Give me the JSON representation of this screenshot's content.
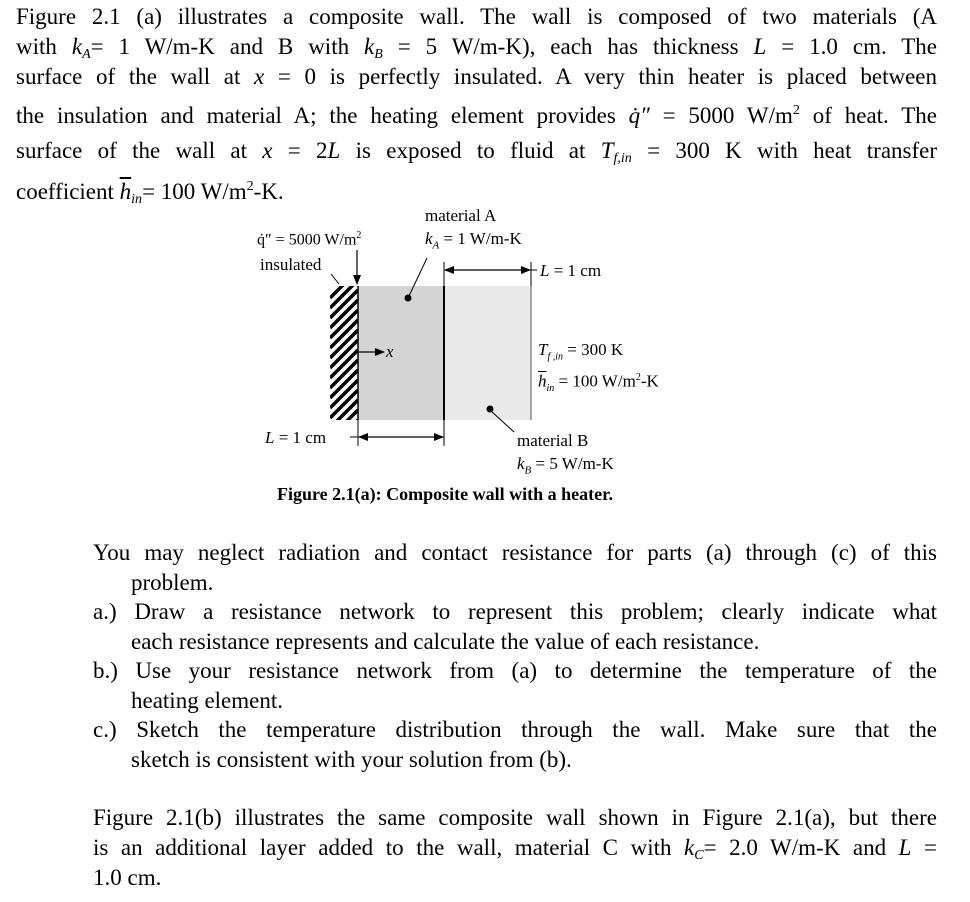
{
  "intro": {
    "lines": [
      [
        "Figure 2.1 (a) illustrates a composite wall.  The wall is composed of two materials (A"
      ],
      [
        "with ",
        "k_A",
        "= 1 W/m-K and B with ",
        "k_B",
        " = 5 W/m-K), each has thickness ",
        "L",
        " = 1.0 cm.  The"
      ],
      [
        "surface of the wall at ",
        "x",
        " = 0 is perfectly insulated.  A very thin heater is placed between"
      ],
      [
        "the insulation and material A; the heating element provides ",
        "q_dot",
        " = 5000 W/m",
        "2",
        " of heat.  The"
      ],
      [
        "surface of the wall at ",
        "x",
        " = 2",
        "L",
        " is exposed to fluid at ",
        "T_f,in",
        " = 300 K with heat transfer"
      ],
      [
        "coefficient ",
        "h_in",
        "= 100 W/m",
        "2",
        "-K."
      ]
    ],
    "text": {
      "l1": "Figure 2.1 (a) illustrates a composite wall.  The wall is composed of two materials (A",
      "l2a": "with ",
      "l2_kA": "k",
      "l2_kA_sub": "A",
      "l2b": "= 1 W/m-K and B with ",
      "l2_kB": "k",
      "l2_kB_sub": "B",
      "l2c": " = 5 W/m-K), each has thickness ",
      "l2_L": "L",
      "l2d": " = 1.0 cm.  The",
      "l3a": "surface of the wall at ",
      "l3_x": "x",
      "l3b": " = 0 is perfectly insulated.  A very thin heater is placed between",
      "l4a": "the insulation and material A; the heating element provides ",
      "l4_q": "q̇″",
      "l4b": " = 5000 W/m",
      "l4_sup": "2",
      "l4c": " of heat.  The",
      "l5a": "surface of the wall at ",
      "l5_x": "x",
      "l5b": " = 2",
      "l5_L": "L",
      "l5c": " is exposed to fluid at ",
      "l5_T": "T",
      "l5_T_sub": "f,in",
      "l5d": " = 300 K with heat transfer",
      "l6a": "coefficient ",
      "l6_h": "h",
      "l6_h_sub": "in",
      "l6b": "= 100 W/m",
      "l6_sup": "2",
      "l6c": "-K."
    }
  },
  "figure": {
    "heat_flux_label": "q̇″ = 5000 W/m",
    "heat_flux_sup": "2",
    "insulated_label": "insulated",
    "material_a_label": "material A",
    "k_a_symbol": "k",
    "k_a_sub": "A",
    "k_a_value": " = 1 W/m-K",
    "length_top_symbol": "L",
    "length_top_value": " =  1 cm",
    "x_axis_label": "x",
    "fluid_temp_symbol": "T",
    "fluid_temp_sub": "f ,in",
    "fluid_temp_value": " = 300 K",
    "h_symbol": "h",
    "h_sub": "in",
    "h_value": " = 100 W/m",
    "h_sup": "2",
    "h_unit": "-K",
    "length_bottom_symbol": "L",
    "length_bottom_value": " =  1 cm",
    "material_b_label": "material B",
    "k_b_symbol": "k",
    "k_b_sub": "B",
    "k_b_value": " = 5 W/m-K",
    "caption": "Figure 2.1(a): Composite wall with a heater.",
    "colors": {
      "material_a": "#d4d4d4",
      "material_b": "#e9e9e9"
    }
  },
  "questions": {
    "intro_line1": "You may neglect radiation and contact resistance for parts (a) through (c) of this",
    "intro_line2": "problem.",
    "items": [
      {
        "marker": "a.)",
        "line1": "Draw a resistance network to represent this problem; clearly indicate what",
        "line2": "each resistance represents and calculate the value of each resistance."
      },
      {
        "marker": "b.)",
        "line1": "Use your resistance network from (a) to determine the temperature of the",
        "line2": "heating element."
      },
      {
        "marker": "c.)",
        "line1": "Sketch the temperature distribution through the wall.  Make sure that the",
        "line2": "sketch is consistent with your solution from (b)."
      }
    ]
  },
  "followup": {
    "line1": "Figure 2.1(b) illustrates the same composite wall shown in Figure 2.1(a), but there",
    "line2a": "is an additional layer added to the wall, material C with ",
    "line2_k": "k",
    "line2_k_sub": "C",
    "line2b": "= 2.0 W/m-K and ",
    "line2_L": "L",
    "line2c": " =",
    "line3": "1.0 cm."
  }
}
